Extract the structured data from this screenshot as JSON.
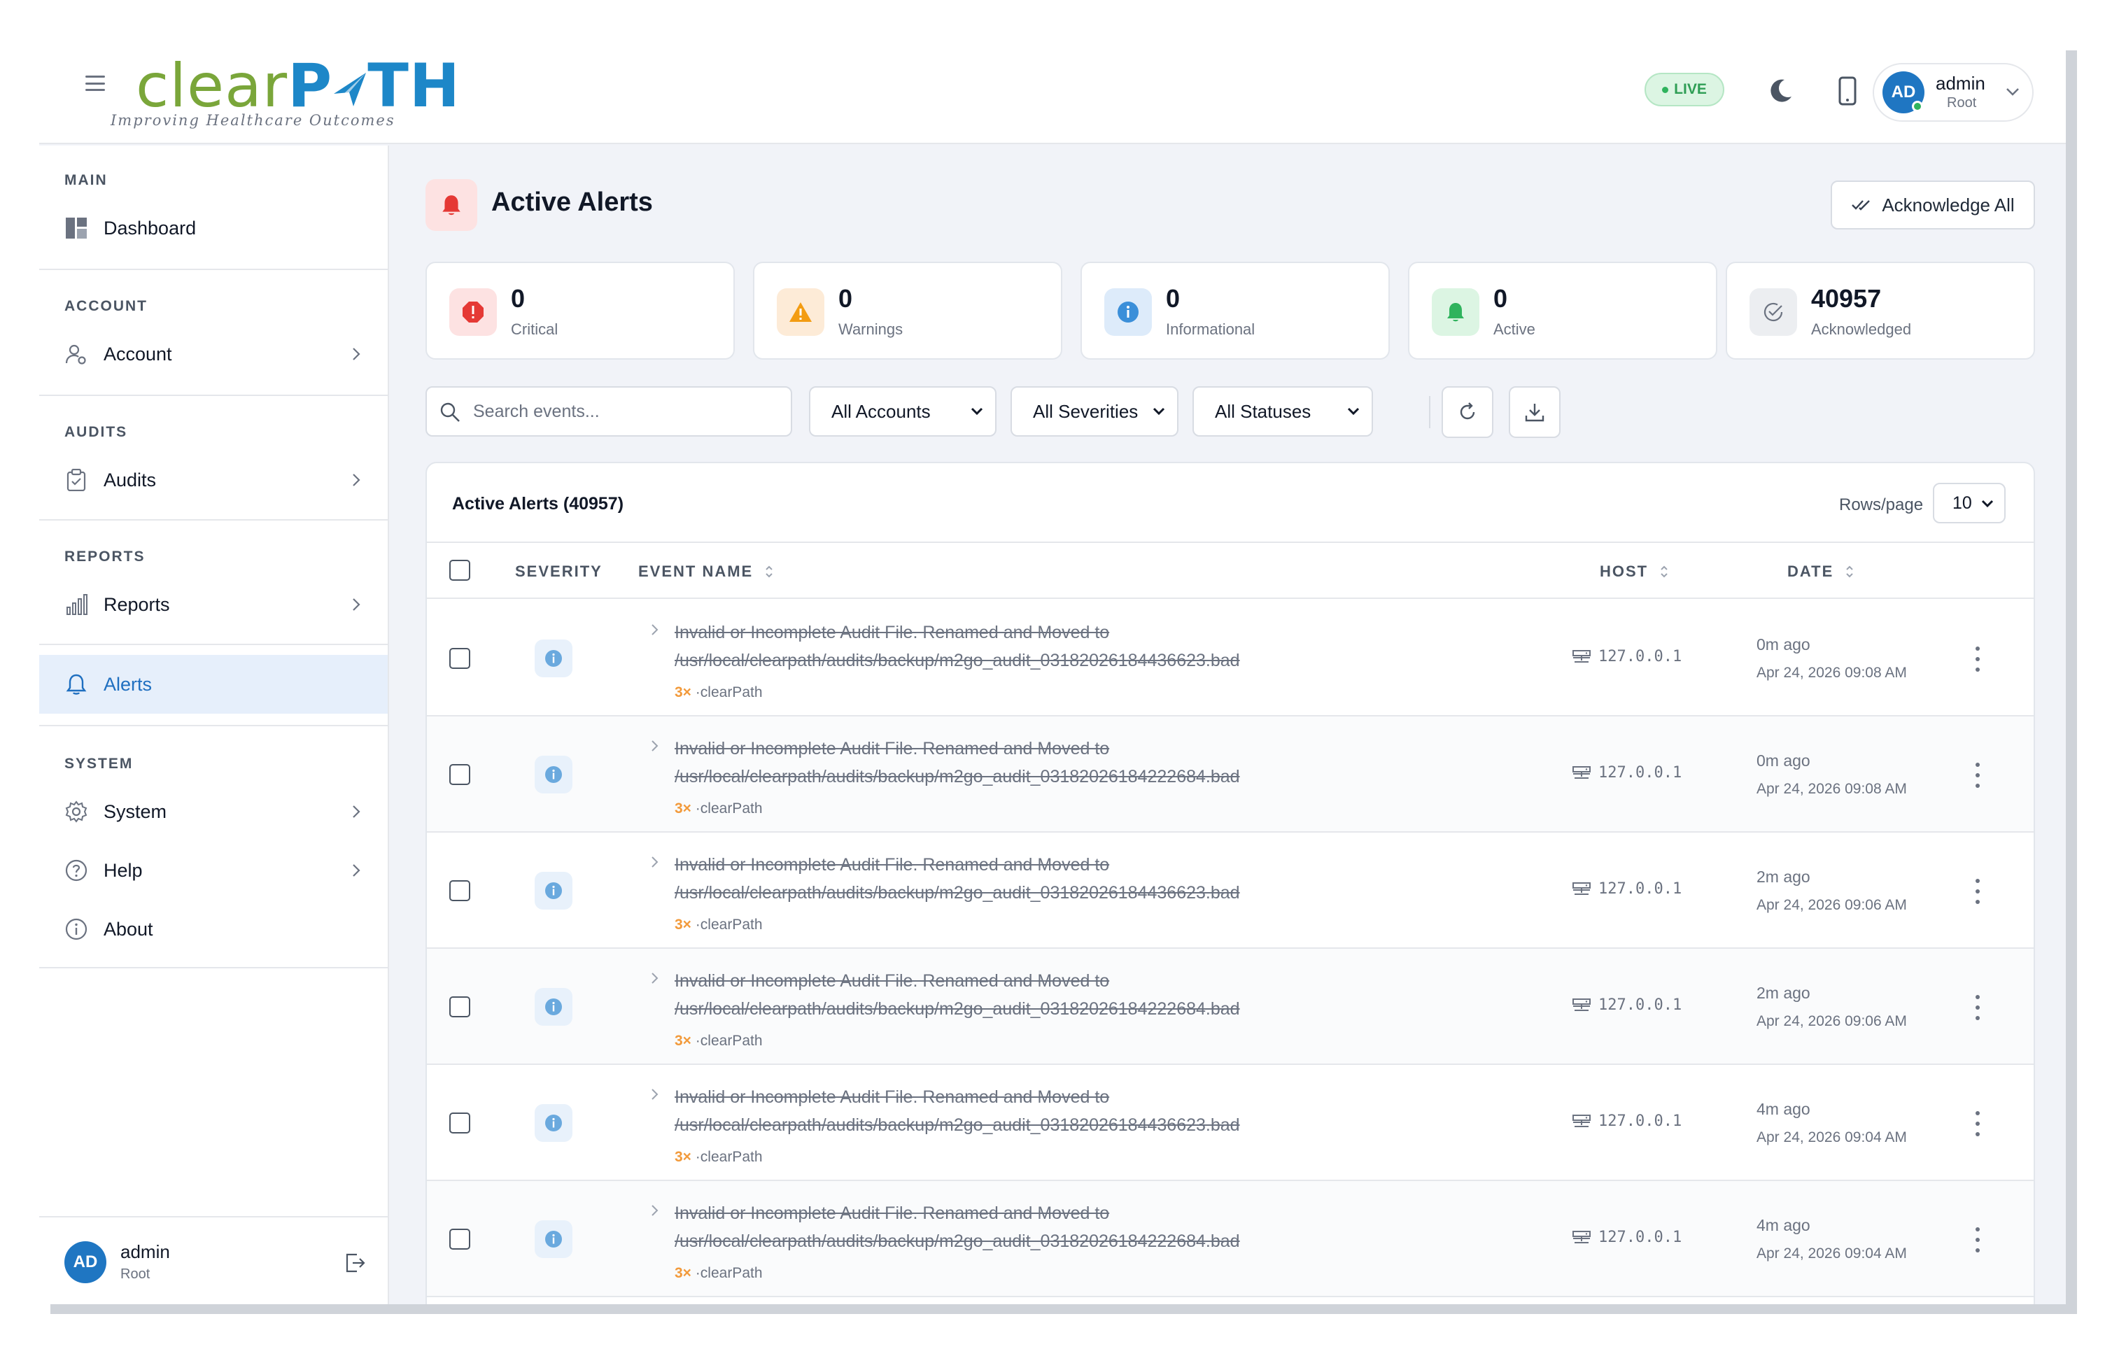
{
  "header": {
    "logo_text_a": "clear",
    "logo_text_b": "P",
    "logo_text_c": "TH",
    "logo_tagline": "Improving Healthcare Outcomes",
    "live_label": "LIVE",
    "user": {
      "initials": "AD",
      "name": "admin",
      "role": "Root"
    }
  },
  "sidebar": {
    "sections": {
      "main": "MAIN",
      "account": "ACCOUNT",
      "audits": "AUDITS",
      "reports": "REPORTS",
      "system": "SYSTEM"
    },
    "items": {
      "dashboard": "Dashboard",
      "account": "Account",
      "audits": "Audits",
      "reports": "Reports",
      "alerts": "Alerts",
      "system": "System",
      "help": "Help",
      "about": "About"
    },
    "user": {
      "initials": "AD",
      "name": "admin",
      "role": "Root"
    }
  },
  "page": {
    "title": "Active Alerts",
    "acknowledge_all": "Acknowledge All"
  },
  "stats": [
    {
      "value": "0",
      "label": "Critical"
    },
    {
      "value": "0",
      "label": "Warnings"
    },
    {
      "value": "0",
      "label": "Informational"
    },
    {
      "value": "0",
      "label": "Active"
    },
    {
      "value": "40957",
      "label": "Acknowledged"
    }
  ],
  "filters": {
    "search_placeholder": "Search events...",
    "accounts": "All Accounts",
    "severities": "All Severities",
    "statuses": "All Statuses"
  },
  "table": {
    "title": "Active Alerts (40957)",
    "rows_per_page_label": "Rows/page",
    "rows_per_page": "10",
    "columns": {
      "severity": "SEVERITY",
      "event_name": "EVENT NAME",
      "host": "HOST",
      "date": "DATE"
    },
    "rows": [
      {
        "name": "Invalid or Incomplete Audit File. Renamed and Moved to /usr/local/clearpath/audits/backup/m2go_audit_03182026184436623.bad",
        "count": "3×",
        "source": "·clearPath",
        "host": "127.0.0.1",
        "relative": "0m ago",
        "date": "Apr 24, 2026 09:08 AM"
      },
      {
        "name": "Invalid or Incomplete Audit File. Renamed and Moved to /usr/local/clearpath/audits/backup/m2go_audit_03182026184222684.bad",
        "count": "3×",
        "source": "·clearPath",
        "host": "127.0.0.1",
        "relative": "0m ago",
        "date": "Apr 24, 2026 09:08 AM"
      },
      {
        "name": "Invalid or Incomplete Audit File. Renamed and Moved to /usr/local/clearpath/audits/backup/m2go_audit_03182026184436623.bad",
        "count": "3×",
        "source": "·clearPath",
        "host": "127.0.0.1",
        "relative": "2m ago",
        "date": "Apr 24, 2026 09:06 AM"
      },
      {
        "name": "Invalid or Incomplete Audit File. Renamed and Moved to /usr/local/clearpath/audits/backup/m2go_audit_03182026184222684.bad",
        "count": "3×",
        "source": "·clearPath",
        "host": "127.0.0.1",
        "relative": "2m ago",
        "date": "Apr 24, 2026 09:06 AM"
      },
      {
        "name": "Invalid or Incomplete Audit File. Renamed and Moved to /usr/local/clearpath/audits/backup/m2go_audit_03182026184436623.bad",
        "count": "3×",
        "source": "·clearPath",
        "host": "127.0.0.1",
        "relative": "4m ago",
        "date": "Apr 24, 2026 09:04 AM"
      },
      {
        "name": "Invalid or Incomplete Audit File. Renamed and Moved to /usr/local/clearpath/audits/backup/m2go_audit_03182026184222684.bad",
        "count": "3×",
        "source": "·clearPath",
        "host": "127.0.0.1",
        "relative": "4m ago",
        "date": "Apr 24, 2026 09:04 AM"
      }
    ]
  },
  "colors": {
    "brand_green": "#7aa63a",
    "brand_blue": "#1d87c8",
    "critical": "#e53935",
    "warning": "#f39c12",
    "info": "#3b8fd9",
    "active": "#2fb35d",
    "accent": "#1f6fc0"
  }
}
